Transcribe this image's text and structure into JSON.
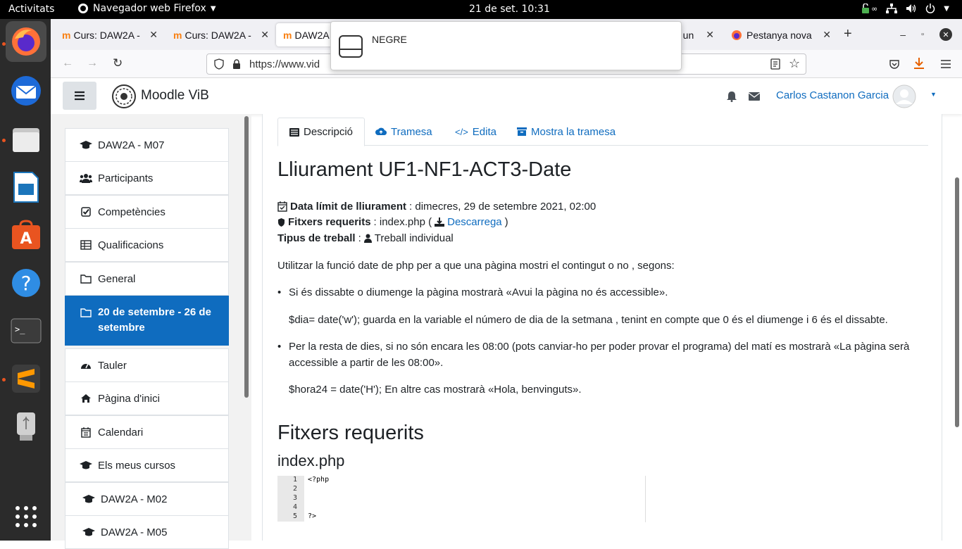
{
  "topbar": {
    "activities": "Activitats",
    "app": "Navegador web Firefox",
    "clock": "21 de set.  10:31",
    "tray_glyph": "∞"
  },
  "browser": {
    "tabs": [
      {
        "label": "Curs: DAW2A - ",
        "icon": "moodle-icon"
      },
      {
        "label": "Curs: DAW2A - ",
        "icon": "moodle-icon"
      },
      {
        "label": "DAW2A",
        "icon": "moodle-icon"
      },
      {
        "label": "ït un",
        "icon": ""
      },
      {
        "label": "Pestanya nova",
        "icon": "firefox-icon"
      }
    ],
    "url": "https://www.vid"
  },
  "popup": {
    "label": "NEGRE"
  },
  "moodle": {
    "site_name": "Moodle ViB",
    "user_name": "Carlos Castanon Garcia"
  },
  "drawer": {
    "items": [
      {
        "label": "DAW2A - M07",
        "icon": "graduation-cap-icon"
      },
      {
        "label": "Participants",
        "icon": "users-icon"
      },
      {
        "label": "Competències",
        "icon": "check-square-icon"
      },
      {
        "label": "Qualificacions",
        "icon": "table-icon"
      },
      {
        "label": "General",
        "icon": "folder-icon"
      },
      {
        "label": "20 de setembre - 26 de setembre",
        "icon": "folder-icon"
      },
      {
        "label": "Tauler",
        "icon": "dashboard-icon"
      },
      {
        "label": "Pàgina d'inici",
        "icon": "home-icon"
      },
      {
        "label": "Calendari",
        "icon": "calendar-icon"
      },
      {
        "label": "Els meus cursos",
        "icon": "graduation-cap-icon"
      },
      {
        "label": "DAW2A - M02",
        "icon": "graduation-cap-icon"
      },
      {
        "label": "DAW2A - M05",
        "icon": "graduation-cap-icon"
      }
    ]
  },
  "content": {
    "tabs": [
      "Descripció",
      "Tramesa",
      "Edita",
      "Mostra la tramesa"
    ],
    "title": "Lliurament UF1-NF1-ACT3-Date",
    "due_label": "Data límit de lliurament",
    "due_value": ": dimecres, 29 de setembre 2021, 02:00",
    "files_label": "Fitxers requerits",
    "files_value": ": index.php (",
    "download": "Descarrega",
    "files_close": ")",
    "type_label": "Tipus de treball",
    "type_sep": ":",
    "type_value": "Treball individual",
    "intro": "Utilitzar la funció date de php per a que una pàgina mostri el contingut o no , segons:",
    "bullet1": "Si és dissabte o diumenge la pàgina mostrarà «Avui la pàgina no és accessible».",
    "bullet1_note": "$dia= date('w'); guarda en la variable el número de dia de la setmana , tenint en compte que 0 és el diumenge i 6 és el dissabte.",
    "bullet2": "Per la resta de dies, si no són encara les 08:00 (pots canviar-ho per poder provar el programa) del matí es mostrarà «La pàgina serà accessible a partir de les 08:00».",
    "bullet2_note": "$hora24 = date('H'); En altre cas mostrarà «Hola, benvinguts».",
    "files_heading": "Fitxers requerits",
    "file_name": "index.php",
    "code": [
      {
        "num": "1",
        "src": "<?php"
      },
      {
        "num": "2",
        "src": ""
      },
      {
        "num": "3",
        "src": ""
      },
      {
        "num": "4",
        "src": ""
      },
      {
        "num": "5",
        "src": "?>"
      }
    ]
  }
}
